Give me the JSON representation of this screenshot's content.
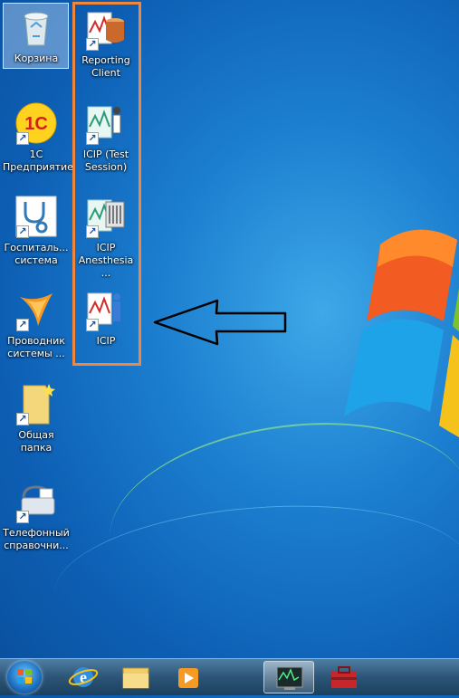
{
  "desktop": {
    "icons_left": [
      {
        "id": "recycle-bin",
        "label": "Корзина",
        "icon": "recycle-bin-icon",
        "selected": true
      },
      {
        "id": "1c",
        "label": "1С\nПредприятие",
        "icon": "1c-icon"
      },
      {
        "id": "hospital",
        "label": "Госпиталь...\nсистема",
        "icon": "stethoscope-icon"
      },
      {
        "id": "explorer",
        "label": "Проводник\nсистемы ...",
        "icon": "boomerang-icon"
      },
      {
        "id": "shared-folder",
        "label": "Общая папка",
        "icon": "folder-icon"
      },
      {
        "id": "phonebook",
        "label": "Телефонный\nсправочни...",
        "icon": "phone-fax-icon"
      }
    ],
    "icons_right": [
      {
        "id": "reporting-client",
        "label": "Reporting\nClient",
        "icon": "reporting-db-icon"
      },
      {
        "id": "icip-test",
        "label": "ICIP (Test\nSession)",
        "icon": "icip-test-icon"
      },
      {
        "id": "icip-anesthesia",
        "label": "ICIP\nAnesthesia ...",
        "icon": "icip-anesthesia-icon"
      },
      {
        "id": "icip",
        "label": "ICIP",
        "icon": "icip-icon"
      }
    ],
    "annotation": {
      "box_color": "#f0873c",
      "arrow": "left-arrow"
    }
  },
  "taskbar": {
    "items": [
      "start-orb",
      "internet-explorer",
      "file-explorer",
      "media-player",
      "icip-monitor",
      "toolbox"
    ],
    "active_item": "icip-monitor"
  }
}
